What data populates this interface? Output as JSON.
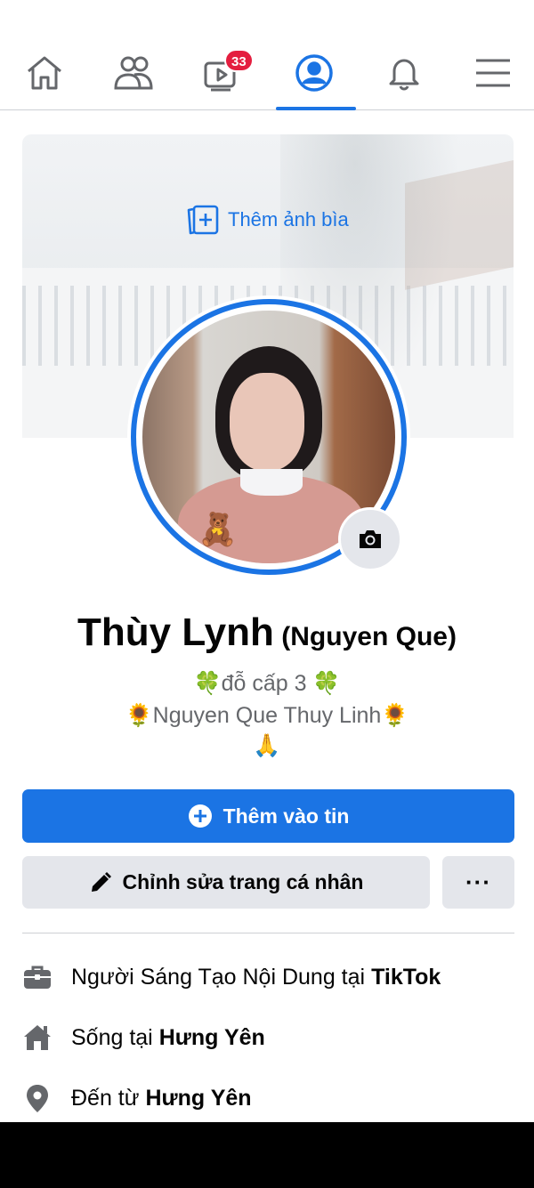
{
  "nav": {
    "tabs": [
      {
        "name": "home",
        "icon": "home-icon"
      },
      {
        "name": "friends",
        "icon": "friends-icon"
      },
      {
        "name": "watch",
        "icon": "video-icon",
        "badge": "33"
      },
      {
        "name": "profile",
        "icon": "profile-icon",
        "active": true
      },
      {
        "name": "notifications",
        "icon": "bell-icon"
      },
      {
        "name": "menu",
        "icon": "hamburger-icon"
      }
    ],
    "active_color": "#1b74e4",
    "badge_color": "#e41e3f"
  },
  "cover": {
    "add_label": "Thêm ảnh bìa"
  },
  "profile": {
    "name": "Thùy Lynh",
    "alt_name": "(Nguyen Que)",
    "bio": [
      "🍀đỗ cấp 3 🍀",
      "🌻Nguyen Que Thuy Linh🌻",
      "🙏"
    ]
  },
  "actions": {
    "add_story": "Thêm vào tin",
    "edit_profile": "Chỉnh sửa trang cá nhân",
    "more": "···"
  },
  "details": [
    {
      "icon": "briefcase-icon",
      "prefix": "Người Sáng Tạo Nội Dung tại",
      "strong": "TikTok"
    },
    {
      "icon": "house-icon",
      "prefix": "Sống tại",
      "strong": "Hưng Yên"
    },
    {
      "icon": "location-pin-icon",
      "prefix": "Đến từ",
      "strong": "Hưng Yên"
    }
  ],
  "colors": {
    "primary": "#1b74e4",
    "secondary_bg": "#e4e6eb",
    "muted_text": "#65676b"
  }
}
